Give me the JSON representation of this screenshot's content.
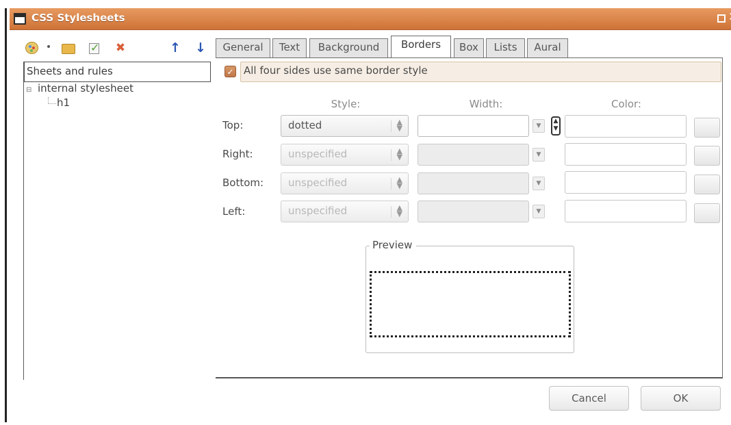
{
  "window": {
    "title": "CSS Stylesheets",
    "icons": [
      "window-icon",
      "maximize-icon",
      "close-icon"
    ]
  },
  "toolbar": {
    "icons": [
      "palette-icon",
      "dropdown-dot-icon",
      "import-folder-icon",
      "edit-rule-icon",
      "delete-icon",
      "move-up-icon",
      "move-down-icon"
    ]
  },
  "tree": {
    "header": "Sheets and rules",
    "items": [
      {
        "label": "internal stylesheet",
        "level": 0,
        "expanded": true
      },
      {
        "label": "h1",
        "level": 1
      }
    ]
  },
  "tabs": [
    {
      "label": "General"
    },
    {
      "label": "Text"
    },
    {
      "label": "Background"
    },
    {
      "label": "Borders",
      "active": true
    },
    {
      "label": "Box"
    },
    {
      "label": "Lists"
    },
    {
      "label": "Aural"
    }
  ],
  "borders": {
    "same_style_label": "All four sides use same border style",
    "same_style_checked": true,
    "columns": {
      "style": "Style:",
      "width": "Width:",
      "color": "Color:"
    },
    "rows": [
      {
        "label": "Top:",
        "style": "dotted",
        "enabled": true,
        "width": "",
        "color": ""
      },
      {
        "label": "Right:",
        "style": "unspecified",
        "enabled": false,
        "width": "",
        "color": ""
      },
      {
        "label": "Bottom:",
        "style": "unspecified",
        "enabled": false,
        "width": "",
        "color": ""
      },
      {
        "label": "Left:",
        "style": "unspecified",
        "enabled": false,
        "width": "",
        "color": ""
      }
    ],
    "preview_label": "Preview"
  },
  "buttons": {
    "cancel": "Cancel",
    "ok": "OK"
  },
  "colors": {
    "titlebar": "#d9814a",
    "checkbox": "#c98a5c",
    "highlight_bar": "#f6eee4"
  }
}
